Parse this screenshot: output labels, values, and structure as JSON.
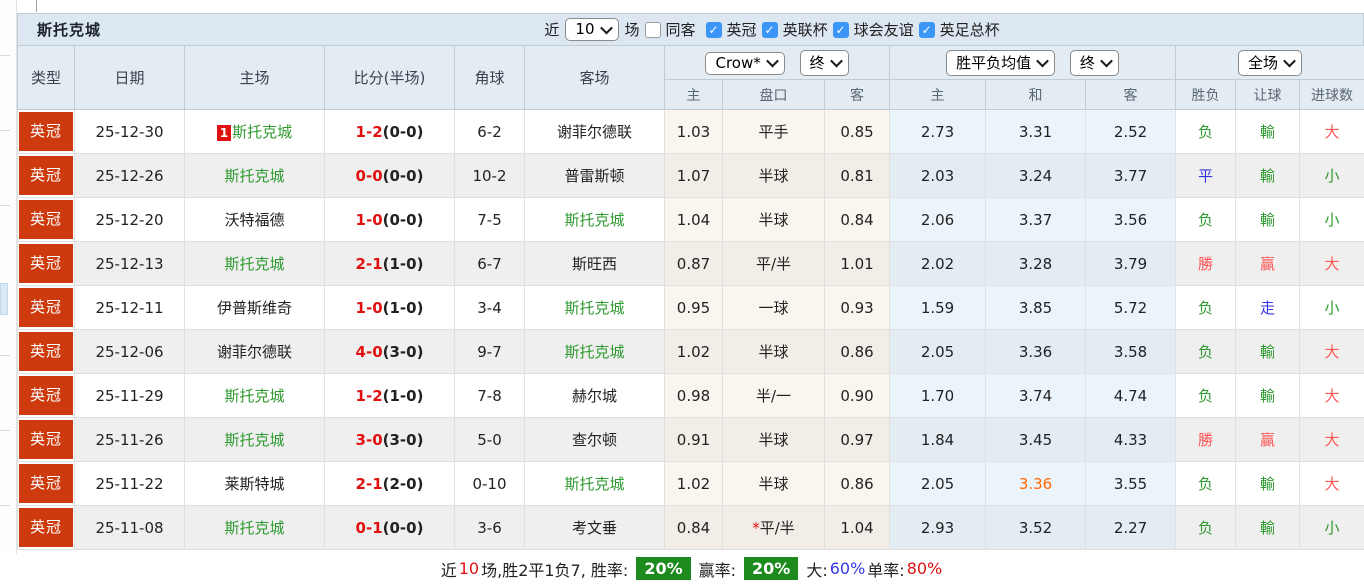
{
  "title": "斯托克城",
  "filter": {
    "recent_label": "近",
    "recent_value": "10",
    "games_label": "场",
    "same_away": {
      "label": "同客",
      "checked": false
    },
    "leagues": [
      {
        "label": "英冠",
        "checked": true
      },
      {
        "label": "英联杯",
        "checked": true
      },
      {
        "label": "球会友谊",
        "checked": true
      },
      {
        "label": "英足总杯",
        "checked": true
      }
    ]
  },
  "header": {
    "cols": [
      "类型",
      "日期",
      "主场",
      "比分(半场)",
      "角球",
      "客场"
    ],
    "crow_select": "Crow*",
    "crow_time_select": "终",
    "avg_select": "胜平负均值",
    "avg_time_select": "终",
    "scope_select": "全场",
    "sub": [
      "主",
      "盘口",
      "客",
      "主",
      "和",
      "客",
      "胜负",
      "让球",
      "进球数"
    ]
  },
  "rows": [
    {
      "league": "英冠",
      "date": "25-12-30",
      "home_badge": "1",
      "home": "斯托克城",
      "home_class": "c-green",
      "score": "1-2",
      "half": "(0-0)",
      "corners": "6-2",
      "away": "谢菲尔德联",
      "away_class": "",
      "ah_home": "1.03",
      "hstar": "",
      "handicap": "平手",
      "ah_away": "0.85",
      "avg_home": "2.73",
      "avg_draw": "3.31",
      "avg_draw_class": "",
      "avg_away": "2.52",
      "result": "负",
      "result_class": "c-green",
      "ah_result": "輸",
      "ah_result_class": "c-green",
      "goals": "大",
      "goals_class": "c-red2"
    },
    {
      "league": "英冠",
      "date": "25-12-26",
      "home_badge": "",
      "home": "斯托克城",
      "home_class": "c-green",
      "score": "0-0",
      "half": "(0-0)",
      "corners": "10-2",
      "away": "普雷斯顿",
      "away_class": "",
      "ah_home": "1.07",
      "hstar": "",
      "handicap": "半球",
      "ah_away": "0.81",
      "avg_home": "2.03",
      "avg_draw": "3.24",
      "avg_draw_class": "",
      "avg_away": "3.77",
      "result": "平",
      "result_class": "c-blue",
      "ah_result": "輸",
      "ah_result_class": "c-green",
      "goals": "小",
      "goals_class": "c-green"
    },
    {
      "league": "英冠",
      "date": "25-12-20",
      "home_badge": "",
      "home": "沃特福德",
      "home_class": "",
      "score": "1-0",
      "half": "(0-0)",
      "corners": "7-5",
      "away": "斯托克城",
      "away_class": "c-green",
      "ah_home": "1.04",
      "hstar": "",
      "handicap": "半球",
      "ah_away": "0.84",
      "avg_home": "2.06",
      "avg_draw": "3.37",
      "avg_draw_class": "",
      "avg_away": "3.56",
      "result": "负",
      "result_class": "c-green",
      "ah_result": "輸",
      "ah_result_class": "c-green",
      "goals": "小",
      "goals_class": "c-green"
    },
    {
      "league": "英冠",
      "date": "25-12-13",
      "home_badge": "",
      "home": "斯托克城",
      "home_class": "c-green",
      "score": "2-1",
      "half": "(1-0)",
      "corners": "6-7",
      "away": "斯旺西",
      "away_class": "",
      "ah_home": "0.87",
      "hstar": "",
      "handicap": "平/半",
      "ah_away": "1.01",
      "avg_home": "2.02",
      "avg_draw": "3.28",
      "avg_draw_class": "",
      "avg_away": "3.79",
      "result": "勝",
      "result_class": "c-red2",
      "ah_result": "贏",
      "ah_result_class": "c-red2",
      "goals": "大",
      "goals_class": "c-red2"
    },
    {
      "league": "英冠",
      "date": "25-12-11",
      "home_badge": "",
      "home": "伊普斯维奇",
      "home_class": "",
      "score": "1-0",
      "half": "(1-0)",
      "corners": "3-4",
      "away": "斯托克城",
      "away_class": "c-green",
      "ah_home": "0.95",
      "hstar": "",
      "handicap": "一球",
      "ah_away": "0.93",
      "avg_home": "1.59",
      "avg_draw": "3.85",
      "avg_draw_class": "",
      "avg_away": "5.72",
      "result": "负",
      "result_class": "c-green",
      "ah_result": "走",
      "ah_result_class": "c-blue",
      "goals": "小",
      "goals_class": "c-green"
    },
    {
      "league": "英冠",
      "date": "25-12-06",
      "home_badge": "",
      "home": "谢菲尔德联",
      "home_class": "",
      "score": "4-0",
      "half": "(3-0)",
      "corners": "9-7",
      "away": "斯托克城",
      "away_class": "c-green",
      "ah_home": "1.02",
      "hstar": "",
      "handicap": "半球",
      "ah_away": "0.86",
      "avg_home": "2.05",
      "avg_draw": "3.36",
      "avg_draw_class": "",
      "avg_away": "3.58",
      "result": "负",
      "result_class": "c-green",
      "ah_result": "輸",
      "ah_result_class": "c-green",
      "goals": "大",
      "goals_class": "c-red2"
    },
    {
      "league": "英冠",
      "date": "25-11-29",
      "home_badge": "",
      "home": "斯托克城",
      "home_class": "c-green",
      "score": "1-2",
      "half": "(1-0)",
      "corners": "7-8",
      "away": "赫尔城",
      "away_class": "",
      "ah_home": "0.98",
      "hstar": "",
      "handicap": "半/一",
      "ah_away": "0.90",
      "avg_home": "1.70",
      "avg_draw": "3.74",
      "avg_draw_class": "",
      "avg_away": "4.74",
      "result": "负",
      "result_class": "c-green",
      "ah_result": "輸",
      "ah_result_class": "c-green",
      "goals": "大",
      "goals_class": "c-red2"
    },
    {
      "league": "英冠",
      "date": "25-11-26",
      "home_badge": "",
      "home": "斯托克城",
      "home_class": "c-green",
      "score": "3-0",
      "half": "(3-0)",
      "corners": "5-0",
      "away": "查尔顿",
      "away_class": "",
      "ah_home": "0.91",
      "hstar": "",
      "handicap": "半球",
      "ah_away": "0.97",
      "avg_home": "1.84",
      "avg_draw": "3.45",
      "avg_draw_class": "",
      "avg_away": "4.33",
      "result": "勝",
      "result_class": "c-red2",
      "ah_result": "贏",
      "ah_result_class": "c-red2",
      "goals": "大",
      "goals_class": "c-red2"
    },
    {
      "league": "英冠",
      "date": "25-11-22",
      "home_badge": "",
      "home": "莱斯特城",
      "home_class": "",
      "score": "2-1",
      "half": "(2-0)",
      "corners": "0-10",
      "away": "斯托克城",
      "away_class": "c-green",
      "ah_home": "1.02",
      "hstar": "",
      "handicap": "半球",
      "ah_away": "0.86",
      "avg_home": "2.05",
      "avg_draw": "3.36",
      "avg_draw_class": "c-orange",
      "avg_away": "3.55",
      "result": "负",
      "result_class": "c-green",
      "ah_result": "輸",
      "ah_result_class": "c-green",
      "goals": "大",
      "goals_class": "c-red2"
    },
    {
      "league": "英冠",
      "date": "25-11-08",
      "home_badge": "",
      "home": "斯托克城",
      "home_class": "c-green",
      "score": "0-1",
      "half": "(0-0)",
      "corners": "3-6",
      "away": "考文垂",
      "away_class": "",
      "ah_home": "0.84",
      "hstar": "*",
      "handicap": "平/半",
      "ah_away": "1.04",
      "avg_home": "2.93",
      "avg_draw": "3.52",
      "avg_draw_class": "",
      "avg_away": "2.27",
      "result": "负",
      "result_class": "c-green",
      "ah_result": "輸",
      "ah_result_class": "c-green",
      "goals": "小",
      "goals_class": "c-green"
    }
  ],
  "footer": {
    "p1": "近",
    "p2": "10",
    "p3": "场,胜2平1负7, 胜率:",
    "win_rate": "20%",
    "p4": "赢率:",
    "win_rate2": "20%",
    "p5": "大:",
    "big_rate": "60%",
    "p6": "单率:",
    "single_rate": "80%"
  },
  "colors": {
    "league_badge": "#cc3a0e",
    "stoke_green": "#2f9a2f",
    "score_red": "#e01111",
    "result_red": "#ff5555",
    "result_blue": "#3535e8",
    "highlight_orange": "#ff6600",
    "rate_badge_green": "#1c8a1c",
    "checked_blue": "#3b96f7"
  }
}
